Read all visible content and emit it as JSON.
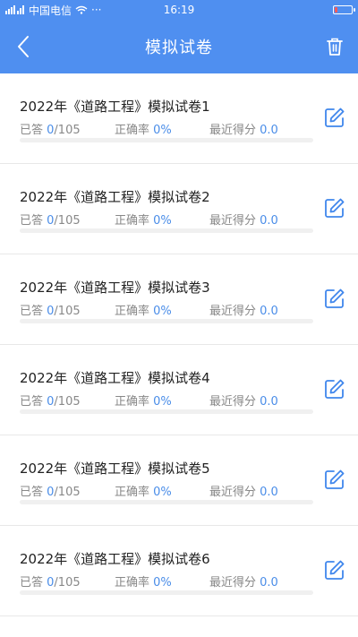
{
  "status_bar": {
    "signal_text": "中国电信",
    "more": "···",
    "time": "16:19",
    "battery_level_percent": 20
  },
  "header": {
    "title": "模拟试卷",
    "back_icon": "chevron-left-icon",
    "trash_icon": "trash-icon"
  },
  "labels": {
    "answered": "已答",
    "accuracy": "正确率",
    "recent_score": "最近得分"
  },
  "exams": [
    {
      "title": "2022年《道路工程》模拟试卷1",
      "answered": "0",
      "total": "/105",
      "accuracy": "0%",
      "score": "0.0",
      "progress": 0
    },
    {
      "title": "2022年《道路工程》模拟试卷2",
      "answered": "0",
      "total": "/105",
      "accuracy": "0%",
      "score": "0.0",
      "progress": 0
    },
    {
      "title": "2022年《道路工程》模拟试卷3",
      "answered": "0",
      "total": "/105",
      "accuracy": "0%",
      "score": "0.0",
      "progress": 0
    },
    {
      "title": "2022年《道路工程》模拟试卷4",
      "answered": "0",
      "total": "/105",
      "accuracy": "0%",
      "score": "0.0",
      "progress": 0
    },
    {
      "title": "2022年《道路工程》模拟试卷5",
      "answered": "0",
      "total": "/105",
      "accuracy": "0%",
      "score": "0.0",
      "progress": 0
    },
    {
      "title": "2022年《道路工程》模拟试卷6",
      "answered": "0",
      "total": "/105",
      "accuracy": "0%",
      "score": "0.0",
      "progress": 0
    }
  ],
  "colors": {
    "primary": "#4f8ff0",
    "accent_text": "#4a8de8"
  }
}
